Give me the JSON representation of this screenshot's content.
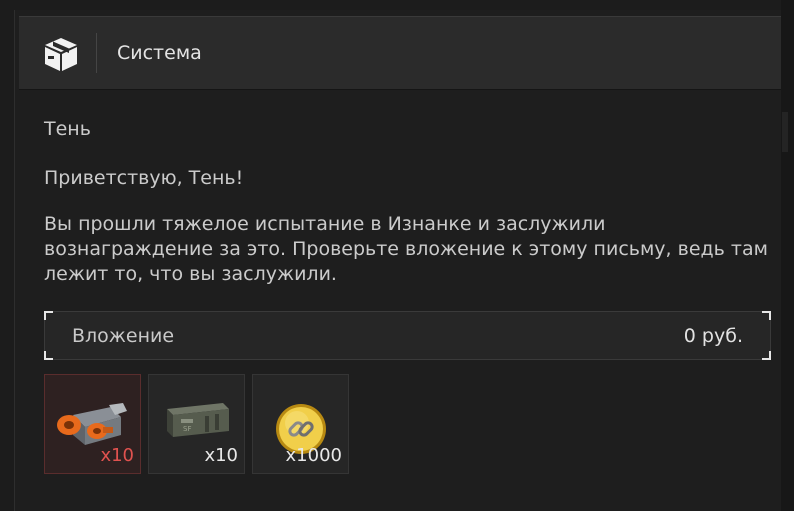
{
  "header": {
    "title": "Система",
    "icon": "box-icon"
  },
  "message": {
    "sender": "Тень",
    "greeting": "Приветствую, Тень!",
    "body": "Вы прошли тяжелое испытание в Изнанке и заслужили вознаграждение за это. Проверьте вложение к этому письму, ведь там лежит то, что вы заслужили."
  },
  "attachment": {
    "label": "Вложение",
    "value": "0 руб."
  },
  "items": [
    {
      "icon": "orange-crate-icon",
      "quantity": "x10",
      "highlight_color": "#e0524f"
    },
    {
      "icon": "ammo-box-icon",
      "quantity": "x10"
    },
    {
      "icon": "gold-coin-chain-icon",
      "quantity": "x1000"
    }
  ]
}
